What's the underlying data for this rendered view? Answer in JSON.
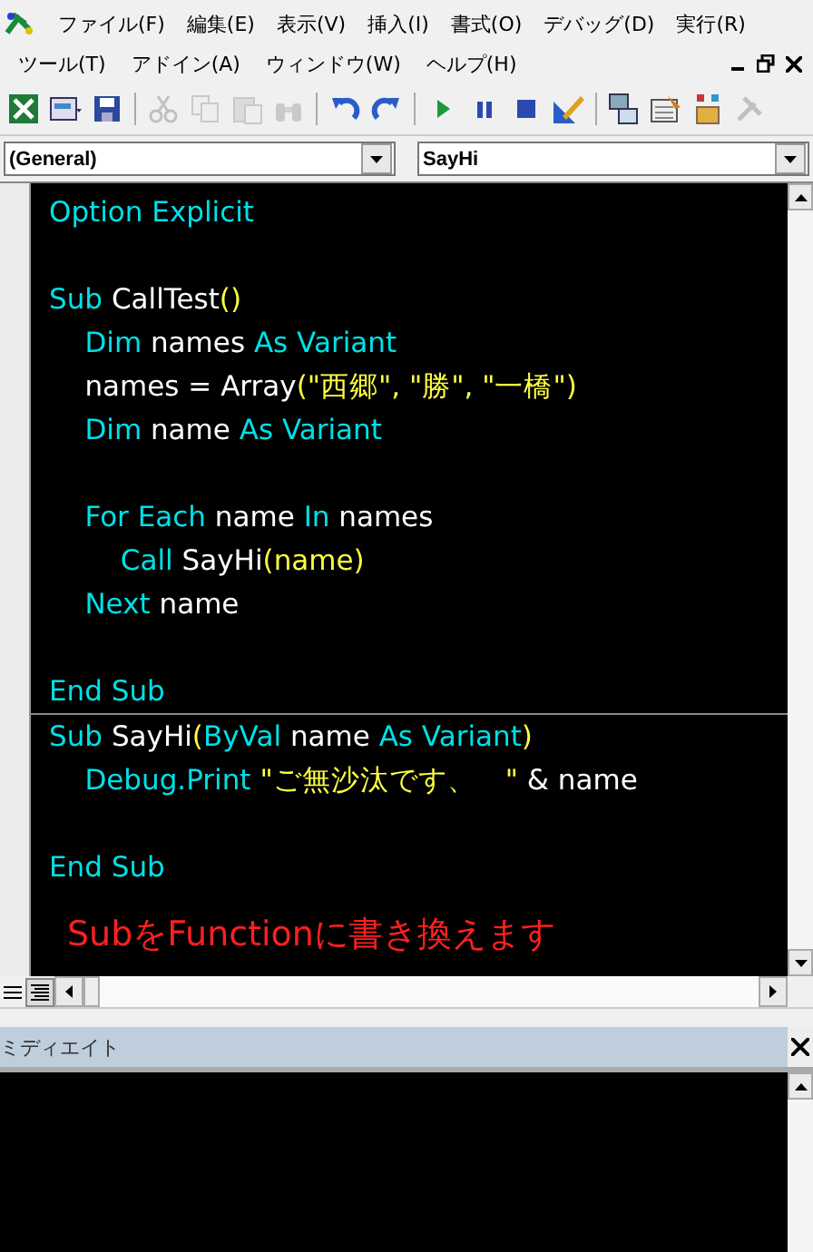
{
  "menu_rows": [
    [
      "ファイル(F)",
      "編集(E)",
      "表示(V)",
      "挿入(I)",
      "書式(O)",
      "デバッグ(D)",
      "実行(R)"
    ],
    [
      "ツール(T)",
      "アドイン(A)",
      "ウィンドウ(W)",
      "ヘルプ(H)"
    ]
  ],
  "toolbar": [
    {
      "kind": "excel",
      "disabled": false
    },
    {
      "kind": "form",
      "disabled": false
    },
    {
      "kind": "save",
      "disabled": false
    },
    {
      "kind": "sep"
    },
    {
      "kind": "cut",
      "disabled": true
    },
    {
      "kind": "copy",
      "disabled": true
    },
    {
      "kind": "paste",
      "disabled": true
    },
    {
      "kind": "find",
      "disabled": true
    },
    {
      "kind": "sep"
    },
    {
      "kind": "undo",
      "disabled": false
    },
    {
      "kind": "redo",
      "disabled": false
    },
    {
      "kind": "sep"
    },
    {
      "kind": "run",
      "disabled": false
    },
    {
      "kind": "pause",
      "disabled": false
    },
    {
      "kind": "stop",
      "disabled": false
    },
    {
      "kind": "design",
      "disabled": false
    },
    {
      "kind": "sep"
    },
    {
      "kind": "project",
      "disabled": false
    },
    {
      "kind": "properties",
      "disabled": false
    },
    {
      "kind": "objects",
      "disabled": false
    },
    {
      "kind": "tools",
      "disabled": true
    }
  ],
  "object_box": "(General)",
  "procedure_box": "SayHi",
  "code_lines": [
    {
      "kind": "code",
      "segments": [
        {
          "t": "Option Explicit",
          "kind": "keyword"
        }
      ]
    },
    {
      "kind": "blank"
    },
    {
      "kind": "code",
      "segments": [
        {
          "t": "Sub ",
          "kind": "keyword"
        },
        {
          "t": "CallTest",
          "kind": "identifier"
        },
        {
          "t": "()",
          "kind": "literal"
        }
      ]
    },
    {
      "kind": "code",
      "segments": [
        {
          "t": "    Dim ",
          "kind": "keyword"
        },
        {
          "t": "names ",
          "kind": "identifier"
        },
        {
          "t": "As Variant",
          "kind": "keyword"
        }
      ]
    },
    {
      "kind": "code",
      "segments": [
        {
          "t": "    names = Array",
          "kind": "identifier"
        },
        {
          "t": "(\"西郷\", \"勝\", \"一橋\")",
          "kind": "literal"
        }
      ]
    },
    {
      "kind": "code",
      "segments": [
        {
          "t": "    Dim ",
          "kind": "keyword"
        },
        {
          "t": "name ",
          "kind": "identifier"
        },
        {
          "t": "As Variant",
          "kind": "keyword"
        }
      ]
    },
    {
      "kind": "blank"
    },
    {
      "kind": "code",
      "segments": [
        {
          "t": "    For Each ",
          "kind": "keyword"
        },
        {
          "t": "name ",
          "kind": "identifier"
        },
        {
          "t": "In ",
          "kind": "keyword"
        },
        {
          "t": "names",
          "kind": "identifier"
        }
      ]
    },
    {
      "kind": "code",
      "segments": [
        {
          "t": "        Call ",
          "kind": "keyword"
        },
        {
          "t": "SayHi",
          "kind": "identifier"
        },
        {
          "t": "(name)",
          "kind": "literal"
        }
      ]
    },
    {
      "kind": "code",
      "segments": [
        {
          "t": "    Next ",
          "kind": "keyword"
        },
        {
          "t": "name",
          "kind": "identifier"
        }
      ]
    },
    {
      "kind": "blank"
    },
    {
      "kind": "code",
      "segments": [
        {
          "t": "End Sub",
          "kind": "keyword"
        }
      ]
    },
    {
      "kind": "divider"
    },
    {
      "kind": "code",
      "segments": [
        {
          "t": "Sub ",
          "kind": "keyword"
        },
        {
          "t": "SayHi",
          "kind": "identifier"
        },
        {
          "t": "(",
          "kind": "literal"
        },
        {
          "t": "ByVal ",
          "kind": "keyword"
        },
        {
          "t": "name ",
          "kind": "identifier"
        },
        {
          "t": "As Variant",
          "kind": "keyword"
        },
        {
          "t": ")",
          "kind": "literal"
        }
      ]
    },
    {
      "kind": "code",
      "segments": [
        {
          "t": "    Debug.Print ",
          "kind": "keyword"
        },
        {
          "t": "\"ご無沙汰です、　\" ",
          "kind": "literal"
        },
        {
          "t": "& name",
          "kind": "identifier"
        }
      ]
    },
    {
      "kind": "blank"
    },
    {
      "kind": "code",
      "segments": [
        {
          "t": "End Sub",
          "kind": "keyword"
        }
      ]
    }
  ],
  "annotation": "SubをFunctionに書き換えます",
  "immediate_title": "ミディエイト"
}
